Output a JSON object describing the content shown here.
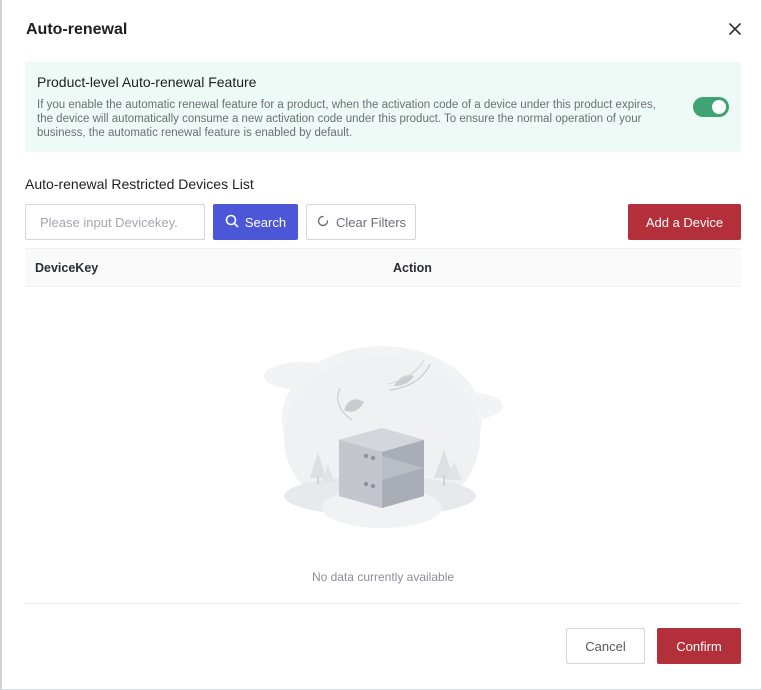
{
  "dialog": {
    "title": "Auto-renewal"
  },
  "feature": {
    "title": "Product-level Auto-renewal Feature",
    "description": "If you enable the automatic renewal feature for a product, when the activation code of a device under this product expires, the device will automatically consume a new activation code under this product. To ensure the normal operation of your business, the automatic renewal feature is enabled by default.",
    "toggle_on": true
  },
  "restricted_list": {
    "title": "Auto-renewal Restricted Devices List",
    "search_placeholder": "Please input Devicekey.",
    "search_value": "",
    "search_label": "Search",
    "clear_label": "Clear Filters",
    "add_label": "Add a Device",
    "columns": [
      "DeviceKey",
      "Action"
    ],
    "rows": [],
    "empty_text": "No data currently available"
  },
  "footer": {
    "cancel_label": "Cancel",
    "confirm_label": "Confirm"
  },
  "colors": {
    "primary": "#4b57d6",
    "danger": "#b3303a",
    "toggle": "#3fa373",
    "feature_bg": "#eefaf6"
  }
}
